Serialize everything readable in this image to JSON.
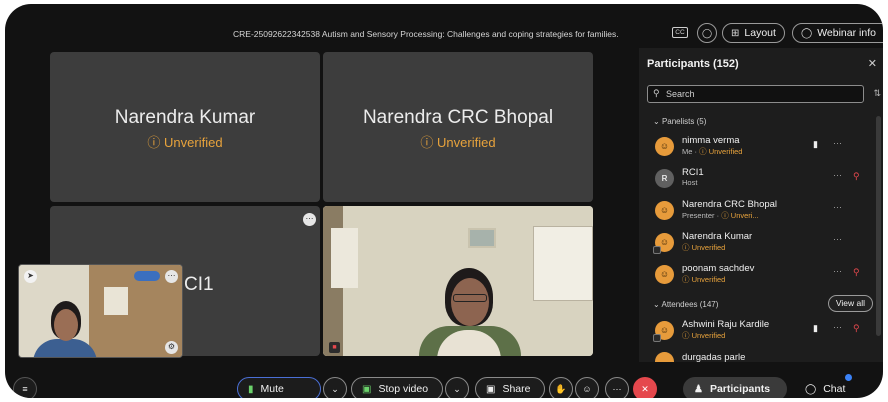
{
  "header": {
    "meeting_title": "CRE-25092622342538 Autism and Sensory Processing: Challenges and coping strategies for families.",
    "cc_label": "CC",
    "layout_label": "Layout",
    "webinar_label": "Webinar info"
  },
  "tiles": [
    {
      "name": "Narendra Kumar",
      "status": "Unverified"
    },
    {
      "name": "Narendra CRC Bhopal",
      "status": "Unverified"
    },
    {
      "name": "RCI1",
      "status": ""
    },
    {
      "name": "",
      "status": ""
    }
  ],
  "self_view": {
    "name_fragment": "CI1"
  },
  "panel": {
    "title": "Participants (152)",
    "search_placeholder": "Search",
    "panelists_label": "Panelists (5)",
    "attendees_label": "Attendees (147)",
    "view_all_label": "View all",
    "panelists": [
      {
        "name": "nimma verma",
        "role": "Me",
        "status": "Unverified",
        "avatar": "person-icon"
      },
      {
        "name": "RCI1",
        "role": "Host",
        "status": "",
        "avatar": "R"
      },
      {
        "name": "Narendra CRC Bhopal",
        "role": "Presenter",
        "status": "Unveri...",
        "avatar": "person-icon"
      },
      {
        "name": "Narendra Kumar",
        "role": "",
        "status": "Unverified",
        "avatar": "person-icon"
      },
      {
        "name": "poonam sachdev",
        "role": "",
        "status": "Unverified",
        "avatar": "person-icon"
      }
    ],
    "attendees": [
      {
        "name": "Ashwini Raju Kardile",
        "status": "Unverified",
        "avatar": "person-icon"
      },
      {
        "name": "durgadas parle",
        "status": "",
        "avatar": "person-icon"
      }
    ]
  },
  "controls": {
    "mute_label": "Mute",
    "stop_video_label": "Stop video",
    "share_label": "Share",
    "participants_label": "Participants",
    "chat_label": "Chat"
  },
  "colors": {
    "unverified": "#e8a33c",
    "end_call": "#e5484d",
    "accent": "#3b82f6"
  }
}
